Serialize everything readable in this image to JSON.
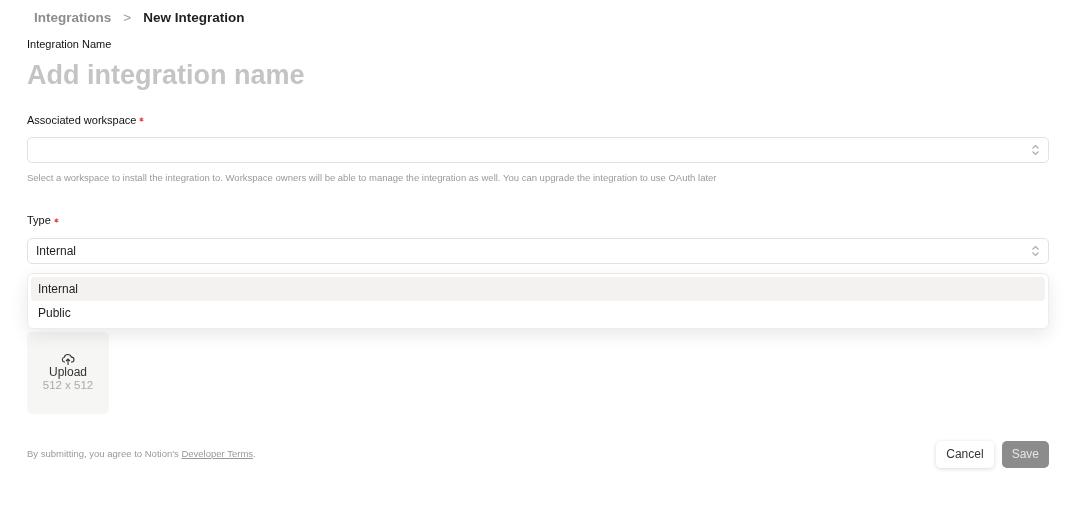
{
  "breadcrumb": {
    "separator": ">",
    "items": [
      {
        "label": "Integrations",
        "current": false
      },
      {
        "label": "New Integration",
        "current": true
      }
    ]
  },
  "name_field": {
    "label": "Integration Name",
    "placeholder": "Add integration name"
  },
  "workspace_field": {
    "label": "Associated workspace",
    "required": true,
    "help": "Select a workspace to install the integration to. Workspace owners will be able to manage the integration as well. You can upgrade the integration to use OAuth later"
  },
  "type_field": {
    "label": "Type",
    "required": true,
    "value": "Internal",
    "options": [
      {
        "label": "Internal",
        "selected": true
      },
      {
        "label": "Public",
        "selected": false
      }
    ]
  },
  "upload": {
    "label": "Upload",
    "size": "512 x 512"
  },
  "footer": {
    "text": "By submitting, you agree to Notion's ",
    "link": "Developer Terms",
    "end": "."
  },
  "buttons": [
    {
      "label": "Cancel",
      "kind": "secondary",
      "disabled": false
    },
    {
      "label": "Save",
      "kind": "primary",
      "disabled": true
    }
  ]
}
